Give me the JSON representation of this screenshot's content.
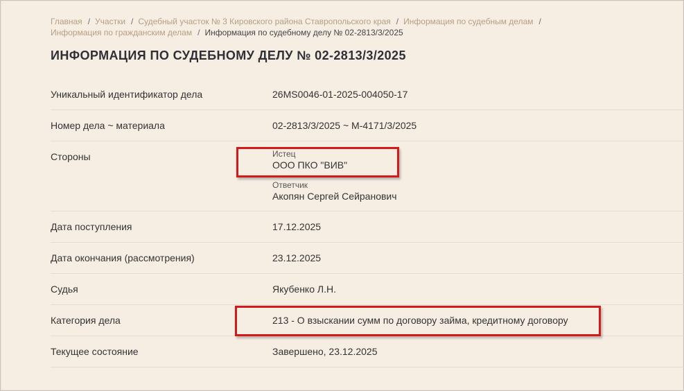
{
  "breadcrumb": {
    "items": [
      "Главная",
      "Участки",
      "Судебный участок № 3 Кировского района Ставропольского края",
      "Информация по судебным делам",
      "Информация по гражданским делам"
    ],
    "current": "Информация по судебному делу № 02-2813/3/2025"
  },
  "page": {
    "title": "ИНФОРМАЦИЯ ПО СУДЕБНОМУ ДЕЛУ № 02-2813/3/2025"
  },
  "details": {
    "uid": {
      "label": "Уникальный идентификатор дела",
      "value": "26MS0046-01-2025-004050-17"
    },
    "number": {
      "label": "Номер дела ~ материала",
      "value": "02-2813/3/2025 ~ М-4171/3/2025"
    },
    "parties": {
      "label": "Стороны",
      "plaintiff_role": "Истец",
      "plaintiff": "ООО ПКО \"ВИВ\"",
      "defendant_role": "Ответчик",
      "defendant": "Акопян Сергей Сейранович"
    },
    "received": {
      "label": "Дата поступления",
      "value": "17.12.2025"
    },
    "finished": {
      "label": "Дата окончания (рассмотрения)",
      "value": "23.12.2025"
    },
    "judge": {
      "label": "Судья",
      "value": "Якубенко Л.Н."
    },
    "category": {
      "label": "Категория дела",
      "value": "213 - О взыскании сумм по договору займа, кредитному договору"
    },
    "status": {
      "label": "Текущее состояние",
      "value": "Завершено, 23.12.2025"
    }
  },
  "colors": {
    "background": "#f6ede3",
    "breadcrumb_link": "#b69f7f",
    "highlight": "#d21a1a"
  }
}
